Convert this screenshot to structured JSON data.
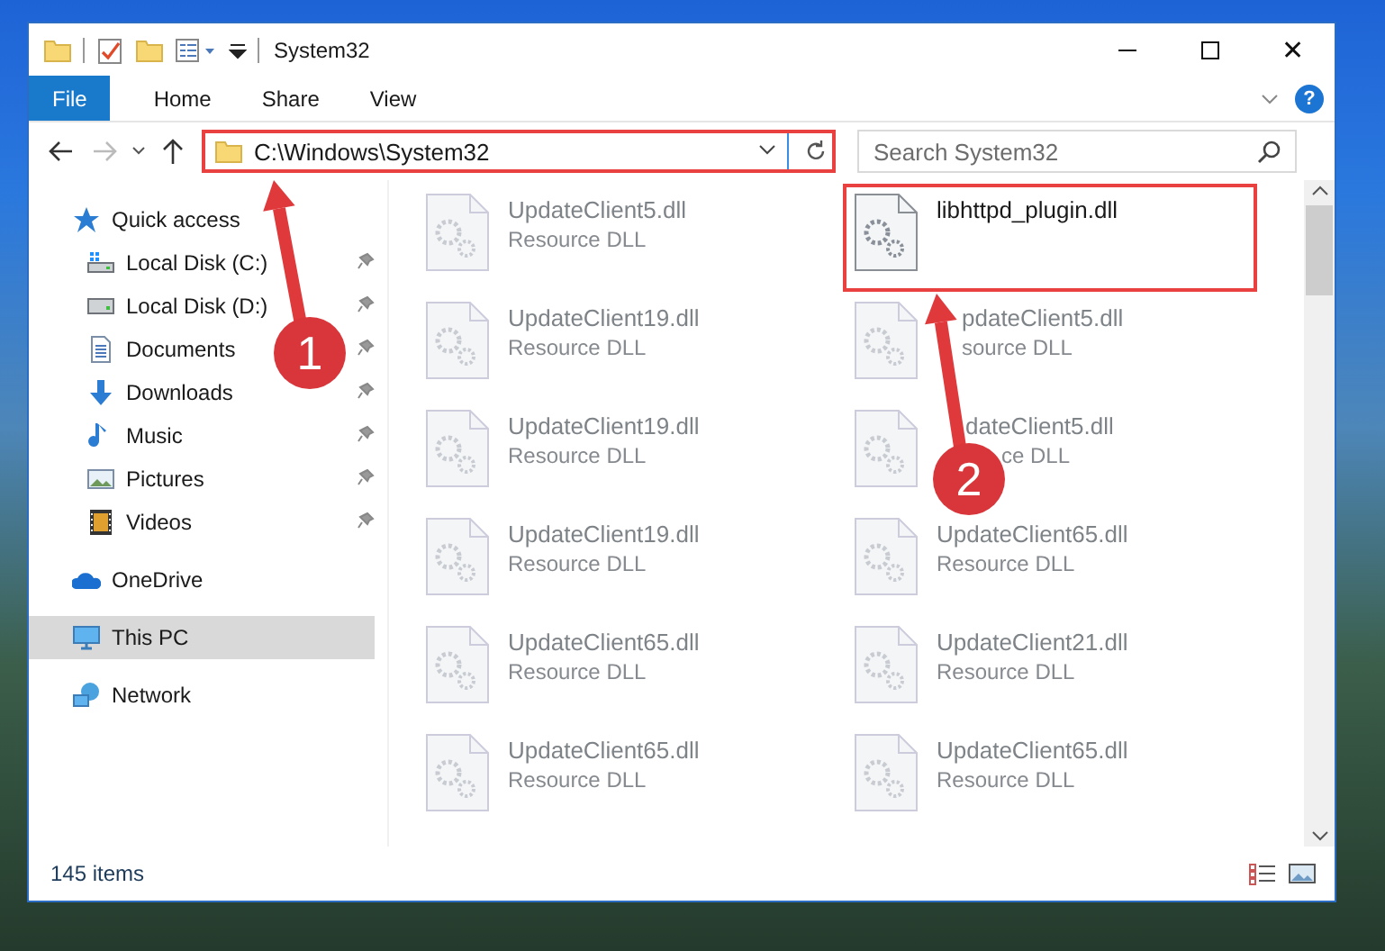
{
  "window": {
    "title": "System32",
    "close_glyph": "✕"
  },
  "ribbon": {
    "tabs": [
      {
        "label": "File",
        "kind": "file",
        "selected": false
      },
      {
        "label": "Home",
        "kind": "tab",
        "selected": false
      },
      {
        "label": "Share",
        "kind": "tab",
        "selected": false
      },
      {
        "label": "View",
        "kind": "tab",
        "selected": false
      }
    ],
    "help_label": "?"
  },
  "address_bar": {
    "path": "C:\\Windows\\System32",
    "highlighted": true
  },
  "search": {
    "placeholder": "Search System32"
  },
  "navigation": [
    {
      "label": "Quick access",
      "kind": "star",
      "selected": false,
      "children": [
        {
          "label": "Local Disk (C:)",
          "kind": "system-disk",
          "selected": false,
          "pinned": true
        },
        {
          "label": "Local Disk (D:)",
          "kind": "disk",
          "selected": false,
          "pinned": true
        },
        {
          "label": "Documents",
          "kind": "documents",
          "selected": false,
          "pinned": true
        },
        {
          "label": "Downloads",
          "kind": "downloads",
          "selected": false,
          "pinned": true
        },
        {
          "label": "Music",
          "kind": "music",
          "selected": false,
          "pinned": true
        },
        {
          "label": "Pictures",
          "kind": "pictures",
          "selected": false,
          "pinned": true
        },
        {
          "label": "Videos",
          "kind": "videos",
          "selected": false,
          "pinned": true
        }
      ]
    },
    {
      "label": "OneDrive",
      "kind": "cloud",
      "selected": false
    },
    {
      "label": "This PC",
      "kind": "pc",
      "selected": true
    },
    {
      "label": "Network",
      "kind": "network",
      "selected": false
    }
  ],
  "files": [
    {
      "name": "UpdateClient5.dll",
      "type": "Resource DLL",
      "kind": "plain",
      "dimmed": true,
      "highlighted": false
    },
    {
      "name": "libhttpd_plugin.dll",
      "kind": "plain",
      "dimmed": false,
      "highlighted": true
    },
    {
      "name": "UpdateClient19.dll",
      "type": "Resource DLL",
      "kind": "plain",
      "dimmed": true,
      "highlighted": false
    },
    {
      "name": "pdateClient5.dll",
      "type": "source DLL",
      "kind": "under-arrow",
      "dimmed": true,
      "highlighted": false
    },
    {
      "name": "UpdateClient19.dll",
      "type": "Resource DLL",
      "kind": "plain",
      "dimmed": true,
      "highlighted": false
    },
    {
      "name": "dateClient5.dll",
      "type": "ce DLL",
      "kind": "under-badge",
      "dimmed": true,
      "highlighted": false
    },
    {
      "name": "UpdateClient19.dll",
      "type": "Resource DLL",
      "kind": "plain",
      "dimmed": true,
      "highlighted": false
    },
    {
      "name": "UpdateClient65.dll",
      "type": "Resource DLL",
      "kind": "plain",
      "dimmed": true,
      "highlighted": false
    },
    {
      "name": "UpdateClient65.dll",
      "type": "Resource DLL",
      "kind": "plain",
      "dimmed": true,
      "highlighted": false
    },
    {
      "name": "UpdateClient21.dll",
      "type": "Resource DLL",
      "kind": "plain",
      "dimmed": true,
      "highlighted": false
    },
    {
      "name": "UpdateClient65.dll",
      "type": "Resource DLL",
      "kind": "plain",
      "dimmed": true,
      "highlighted": false
    },
    {
      "name": "UpdateClient65.dll",
      "type": "Resource DLL",
      "kind": "plain",
      "dimmed": true,
      "highlighted": false
    }
  ],
  "status_bar": {
    "item_count": "145 items"
  },
  "annotations": [
    {
      "label": "1"
    },
    {
      "label": "2"
    }
  ]
}
